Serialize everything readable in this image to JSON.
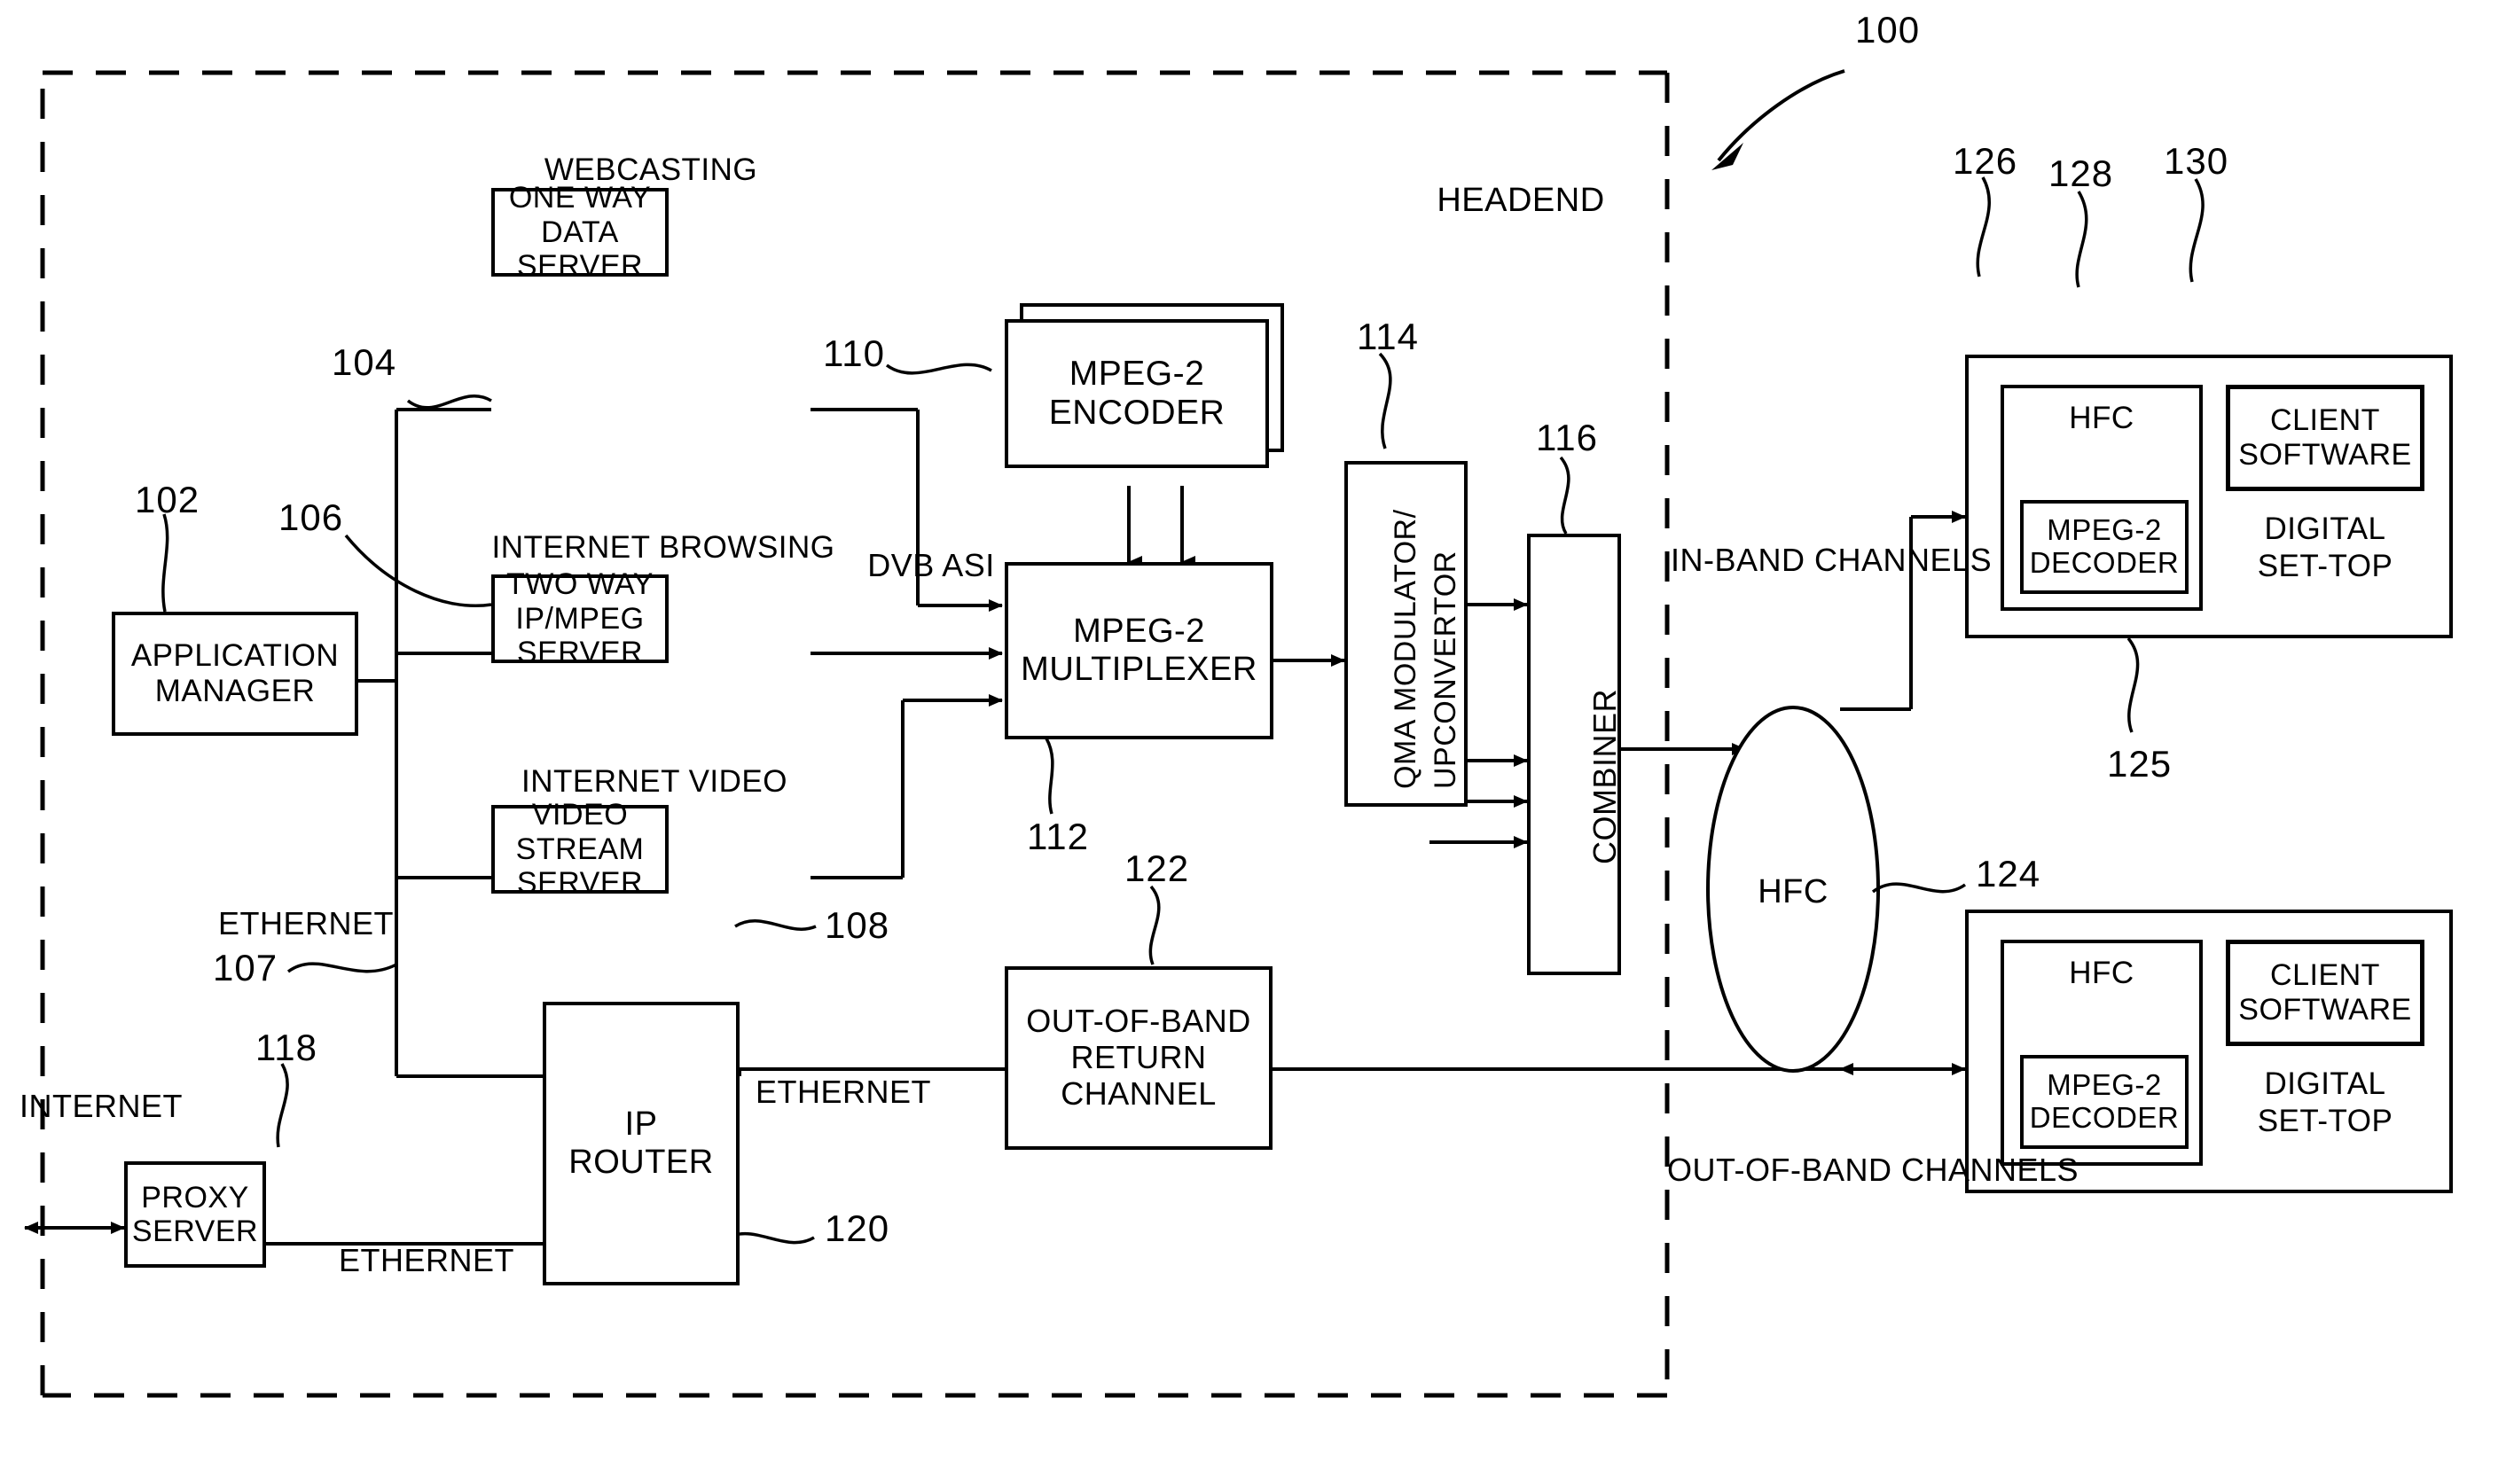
{
  "figure": {
    "ref_main": "100",
    "headend_label": "HEADEND",
    "internet_label": "INTERNET"
  },
  "blocks": {
    "application_manager": {
      "lines": [
        "APPLICATION",
        "MANAGER"
      ],
      "ref": "102"
    },
    "one_way_data_server": {
      "caption": "WEBCASTING",
      "lines": [
        "ONE WAY",
        "DATA",
        "SERVER"
      ],
      "ref": "104"
    },
    "two_way_ip_mpeg_server": {
      "caption": "INTERNET BROWSING",
      "lines": [
        "TWO WAY",
        "IP/MPEG",
        "SERVER"
      ],
      "ref": "106"
    },
    "video_stream_server": {
      "caption": "INTERNET VIDEO",
      "lines": [
        "VIDEO",
        "STREAM",
        "SERVER"
      ],
      "ref": "108"
    },
    "mpeg2_encoder": {
      "lines": [
        "MPEG-2",
        "ENCODER"
      ],
      "ref": "110"
    },
    "mpeg2_multiplexer": {
      "lines": [
        "MPEG-2",
        "MULTIPLEXER"
      ],
      "ref": "112"
    },
    "qma_modulator": {
      "lines": [
        "QMA MODULATOR/",
        "UPCONVERTOR"
      ],
      "ref": "114"
    },
    "combiner": {
      "lines": [
        "COMBINER"
      ],
      "ref": "116"
    },
    "proxy_server": {
      "lines": [
        "PROXY",
        "SERVER"
      ],
      "ref": "118"
    },
    "ip_router": {
      "lines": [
        "IP",
        "ROUTER"
      ],
      "ref": "120"
    },
    "out_of_band_return_channel": {
      "lines": [
        "OUT-OF-BAND",
        "RETURN",
        "CHANNEL"
      ],
      "ref": "122"
    },
    "hfc_network": {
      "label": "HFC",
      "ref": "124"
    },
    "set_top_upper": {
      "hfc_label": "HFC",
      "decoder_lines": [
        "MPEG-2",
        "DECODER"
      ],
      "client_lines": [
        "CLIENT",
        "SOFTWARE"
      ],
      "device_lines": [
        "DIGITAL",
        "SET-TOP"
      ],
      "ref_outer": "126",
      "ref_hfc": "128",
      "ref_client": "130",
      "ref_decoder": "125"
    },
    "set_top_lower": {
      "hfc_label": "HFC",
      "decoder_lines": [
        "MPEG-2",
        "DECODER"
      ],
      "client_lines": [
        "CLIENT",
        "SOFTWARE"
      ],
      "device_lines": [
        "DIGITAL",
        "SET-TOP"
      ]
    }
  },
  "connection_labels": {
    "ethernet_bus": "ETHERNET",
    "ethernet_bus_ref": "107",
    "dvb_asi": "DVB ASI",
    "ethernet_router_left": "ETHERNET",
    "ethernet_router_right": "ETHERNET",
    "in_band_channels": [
      "IN-BAND",
      "CHANNELS"
    ],
    "out_of_band_channels": [
      "OUT-OF-BAND",
      "CHANNELS"
    ]
  }
}
